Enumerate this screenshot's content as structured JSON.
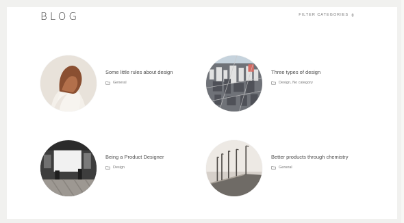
{
  "header": {
    "brand": "BLOG",
    "filter_label": "FILTER CATEGORIES"
  },
  "posts": [
    {
      "title": "Some little rules about design",
      "categories": "General",
      "thumbnail_icon": "portrait-photo",
      "folder_icon": "folder-icon"
    },
    {
      "title": "Three types of design",
      "categories": "Design, No category",
      "thumbnail_icon": "city-photo",
      "folder_icon": "folder-icon"
    },
    {
      "title": "Being a Product Designer",
      "categories": "Design",
      "thumbnail_icon": "studio-photo",
      "folder_icon": "folder-icon"
    },
    {
      "title": "Better products through chemistry",
      "categories": "General",
      "thumbnail_icon": "pier-photo",
      "folder_icon": "folder-icon"
    }
  ],
  "colors": {
    "background": "#f1f1ef",
    "card": "#ffffff",
    "text": "#4a4a4a",
    "muted": "#777777"
  }
}
